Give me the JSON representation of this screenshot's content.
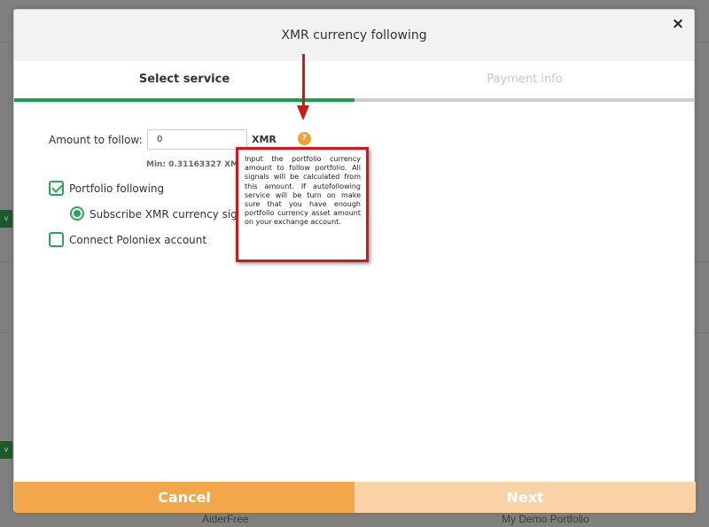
{
  "modal": {
    "title": "XMR currency following",
    "close_label": "×"
  },
  "tabs": [
    {
      "label": "Select service",
      "active": true
    },
    {
      "label": "Payment info",
      "active": false
    }
  ],
  "form": {
    "amount_label": "Amount to follow:",
    "amount_value": "0",
    "currency_unit": "XMR",
    "help_icon_label": "?",
    "min_text": "Min: 0.31163327 XMR",
    "portfolio_following_label": "Portfolio following",
    "portfolio_following_checked": true,
    "subscribe_label": "Subscribe XMR currency signals",
    "subscribe_selected": true,
    "connect_label": "Connect Poloniex account",
    "connect_checked": false
  },
  "tooltip": {
    "text": "Input the portfolio currency amount to follow portfolio. All signals will be calculated from this amount. If autofollowing service will be turn on make sure that you have enough portfolio currency asset amount on your exchange account."
  },
  "footer": {
    "cancel_label": "Cancel",
    "next_label": "Next"
  },
  "background": {
    "tag_label": "v",
    "footer_left": "AiderFree",
    "footer_right": "My Demo Portfolio"
  },
  "colors": {
    "accent_green": "#1a9e48",
    "cancel_orange": "#f4a64a",
    "next_orange_disabled": "#f9d2a6",
    "annotation_red": "#d01818",
    "help_orange": "#f0a030"
  }
}
